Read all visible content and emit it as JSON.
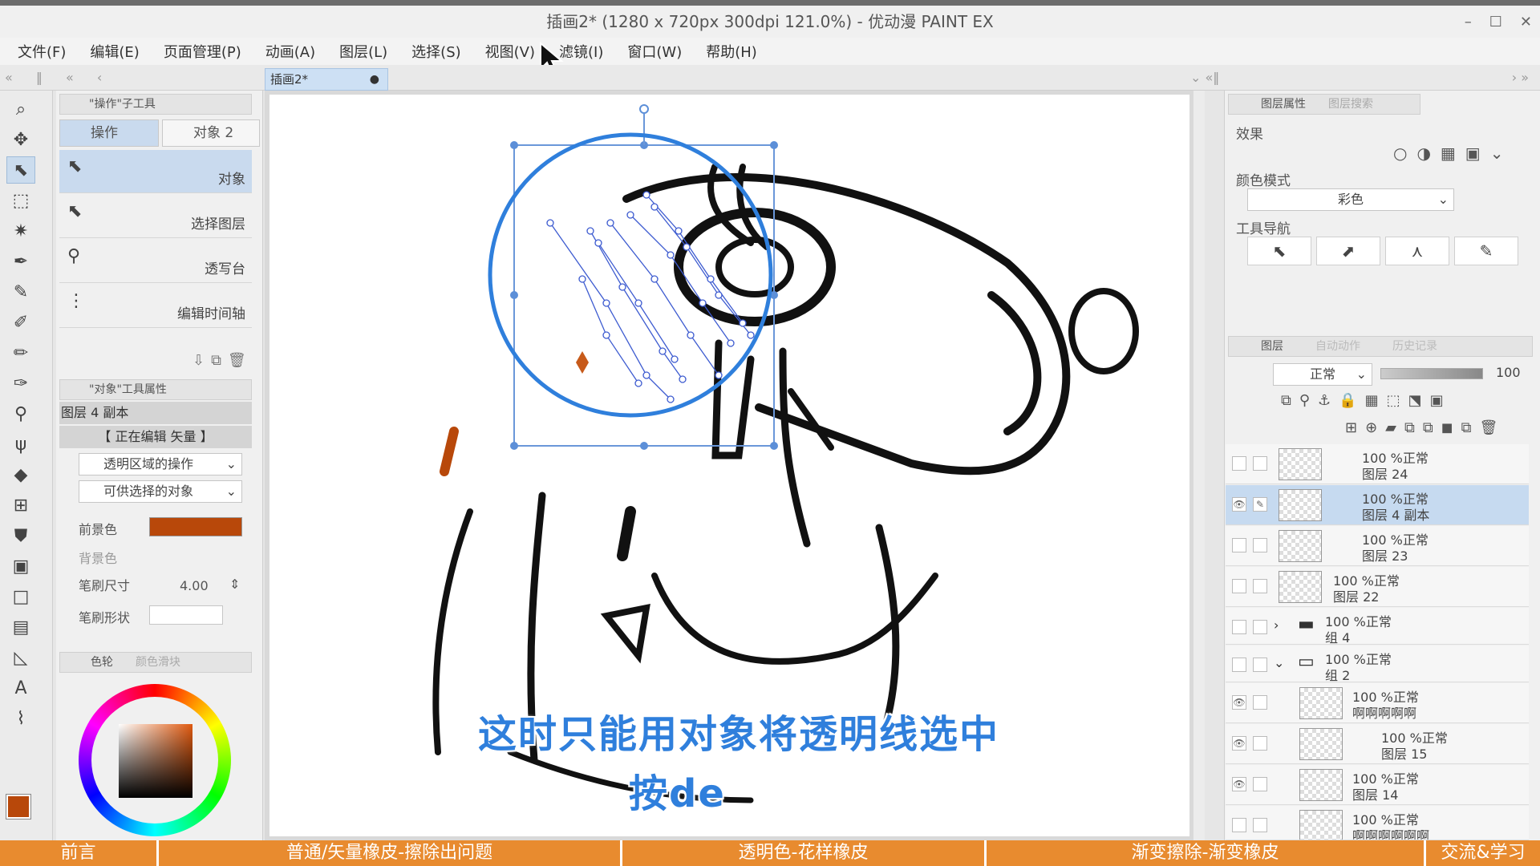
{
  "title": "插画2* (1280 x 720px 300dpi 121.0%)  - 优动漫 PAINT EX",
  "window_controls": [
    "–",
    "☐",
    "✕"
  ],
  "menu": [
    "文件(F)",
    "编辑(E)",
    "页面管理(P)",
    "动画(A)",
    "图层(L)",
    "选择(S)",
    "视图(V)",
    "滤镜(I)",
    "窗口(W)",
    "帮助(H)"
  ],
  "doc_tab": {
    "label": "插画2*",
    "modified_mark": "●"
  },
  "sub_tool": {
    "panel_title": "\"操作\"子工具",
    "mode_tabs": [
      "操作",
      "对象 2"
    ],
    "items": [
      "对象",
      "选择图层",
      "透写台",
      "编辑时间轴"
    ]
  },
  "tool_property": {
    "panel_title": "\"对象\"工具属性",
    "layer_name": "图层 4 副本",
    "editing_status": "【 正在编辑 矢量 】",
    "transparent_op": "透明区域的操作",
    "selectable_obj": "可供选择的对象",
    "fg_label": "前景色",
    "fg_color": "#b8480a",
    "bg_label": "背景色",
    "brush_size_label": "笔刷尺寸",
    "brush_size_value": "4.00",
    "brush_shape_label": "笔刷形状"
  },
  "color_panel": {
    "tab1": "色轮",
    "tab2": "颜色滑块"
  },
  "layer_props": {
    "tab1": "图层属性",
    "tab2": "图层搜索",
    "effect_label": "效果",
    "color_mode_label": "颜色模式",
    "color_mode_value": "彩色",
    "tool_nav_label": "工具导航"
  },
  "layers_panel": {
    "tabs": [
      "图层",
      "自动动作",
      "历史记录"
    ],
    "blend_mode": "正常",
    "opacity": "100",
    "layers": [
      {
        "pct": "100 %正常",
        "name": "图层 24",
        "selected": false,
        "kind": "layer"
      },
      {
        "pct": "100 %正常",
        "name": "图层 4 副本",
        "selected": true,
        "kind": "layer"
      },
      {
        "pct": "100 %正常",
        "name": "图层 23",
        "selected": false,
        "kind": "layer"
      },
      {
        "pct": "100 %正常",
        "name": "图层 22",
        "selected": false,
        "kind": "layer"
      },
      {
        "pct": "100 %正常",
        "name": "组 4",
        "selected": false,
        "kind": "folder"
      },
      {
        "pct": "100 %正常",
        "name": "组 2",
        "selected": false,
        "kind": "folder"
      },
      {
        "pct": "100 %正常",
        "name": "啊啊啊啊啊",
        "selected": false,
        "kind": "layer"
      },
      {
        "pct": "100 %正常",
        "name": "图层 15",
        "selected": false,
        "kind": "layer"
      },
      {
        "pct": "100 %正常",
        "name": "图层 14",
        "selected": false,
        "kind": "layer"
      },
      {
        "pct": "100 %正常",
        "name": "啊啊啊啊啊啊",
        "selected": false,
        "kind": "layer"
      }
    ]
  },
  "subtitles": [
    "这时只能用对象将透明线选中",
    "按de"
  ],
  "chapters": [
    "前言",
    "普通/矢量橡皮-擦除出问题",
    "透明色-花样橡皮",
    "渐变擦除-渐变橡皮",
    "交流&学习"
  ],
  "colors": {
    "accent": "#2f7fdc",
    "chapter_bar": "#e88b2f",
    "selection": "#c9daee"
  }
}
